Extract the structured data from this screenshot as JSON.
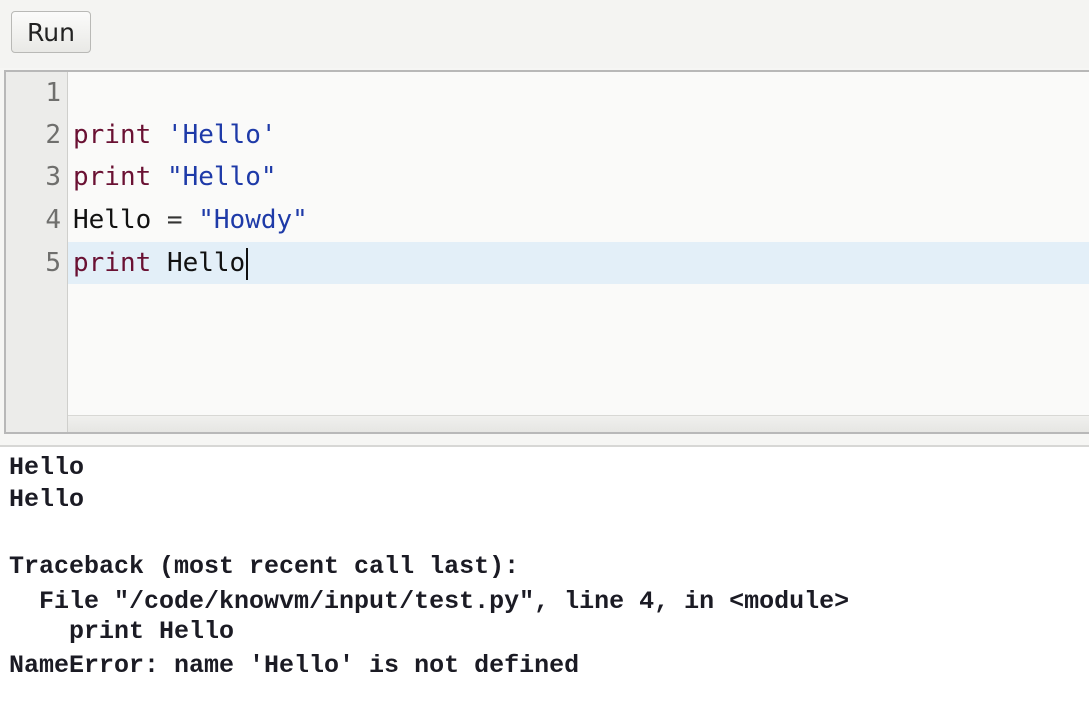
{
  "toolbar": {
    "run_label": "Run"
  },
  "editor": {
    "line_numbers": [
      "1",
      "2",
      "3",
      "4",
      "5"
    ],
    "lines": [
      {
        "tokens": []
      },
      {
        "tokens": [
          {
            "t": "print",
            "c": "kw"
          },
          {
            "t": " ",
            "c": "op"
          },
          {
            "t": "'Hello'",
            "c": "str"
          }
        ]
      },
      {
        "tokens": [
          {
            "t": "print",
            "c": "kw"
          },
          {
            "t": " ",
            "c": "op"
          },
          {
            "t": "\"Hello\"",
            "c": "str"
          }
        ]
      },
      {
        "tokens": [
          {
            "t": "Hello",
            "c": "id"
          },
          {
            "t": " = ",
            "c": "op"
          },
          {
            "t": "\"Howdy\"",
            "c": "str"
          }
        ]
      },
      {
        "tokens": [
          {
            "t": "print",
            "c": "kw"
          },
          {
            "t": " ",
            "c": "op"
          },
          {
            "t": "Hello",
            "c": "id"
          }
        ]
      }
    ],
    "active_line": "5"
  },
  "output": {
    "lines": [
      "Hello",
      "Hello",
      "",
      "Traceback (most recent call last):",
      "  File \"/code/knowvm/input/test.py\", line 4, in <module>",
      "    print Hello",
      "NameError: name 'Hello' is not defined"
    ]
  },
  "colors": {
    "keyword": "#6a1133",
    "string": "#1e3aa8",
    "active_line_bg": "#e3eff8"
  }
}
